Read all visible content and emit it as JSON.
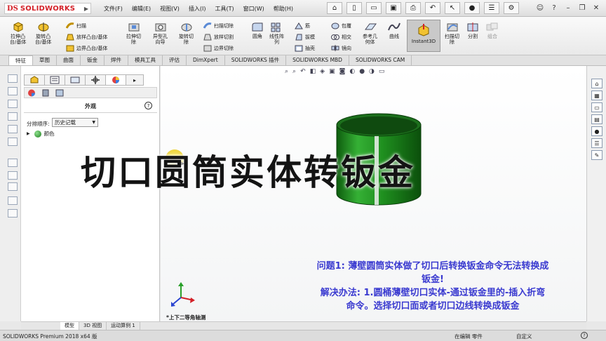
{
  "app": {
    "logo_mark": "DS",
    "logo_text": "SOLIDWORKS"
  },
  "menu": [
    "文件(F)",
    "编辑(E)",
    "视图(V)",
    "插入(I)",
    "工具(T)",
    "窗口(W)",
    "帮助(H)"
  ],
  "quick_toolbar_icons": [
    "home-icon",
    "new-document-icon",
    "open-icon",
    "save-icon",
    "print-icon",
    "undo-icon",
    "select-arrow-icon",
    "traffic-light-icon",
    "options-icon",
    "gear-icon"
  ],
  "window_controls": [
    "user-icon",
    "help-icon",
    "minimize-icon",
    "restore-icon",
    "close-icon"
  ],
  "ribbon": {
    "large": [
      {
        "label1": "拉伸凸",
        "label2": "台/基体"
      },
      {
        "label1": "旋转凸",
        "label2": "台/基体"
      },
      {
        "label1": "拉伸切",
        "label2": "除"
      },
      {
        "label1": "异型孔",
        "label2": "向导"
      },
      {
        "label1": "旋转切",
        "label2": "除"
      },
      {
        "label1": "圆角",
        "label2": ""
      },
      {
        "label1": "线性阵",
        "label2": "列"
      },
      {
        "label1": "参考几",
        "label2": "何体"
      },
      {
        "label1": "曲线",
        "label2": ""
      },
      {
        "label1": "扫描切",
        "label2": "除"
      },
      {
        "label1": "分割",
        "label2": ""
      },
      {
        "label1": "组合",
        "label2": ""
      }
    ],
    "small": {
      "sweep": "扫描",
      "loft_boss": "放样凸台/基体",
      "boundary_boss": "边界凸台/基体",
      "sweep_cut": "扫描切除",
      "loft_cut": "放样切割",
      "boundary_cut": "边界切除",
      "rib": "筋",
      "draft": "拔模",
      "shell": "抽壳",
      "wrap": "包覆",
      "intersect": "相交",
      "mirror": "镜向"
    },
    "instant3d": "Instant3D"
  },
  "tabs": [
    "特征",
    "草图",
    "曲面",
    "钣金",
    "焊件",
    "模具工具",
    "评估",
    "DimXpert",
    "SOLIDWORKS 插件",
    "SOLIDWORKS MBD",
    "SOLIDWORKS CAM"
  ],
  "panel": {
    "title": "外观",
    "help": "?",
    "sort_label": "分排顺序:",
    "sort_value": "历史记载",
    "tree_item": "颜色"
  },
  "viewport": {
    "view_name": "*上下二等角轴测",
    "overlay_title": "切口圆筒实体转钣金",
    "problem_line1": "问题1: 薄壁圆筒实体做了切口后转换钣金命令无法转换成",
    "problem_line2": "钣金!",
    "problem_line3": "解决办法: 1.圆桶薄壁切口实体-通过钣金里的-插入折弯",
    "problem_line4": "命令。选择切口面或者切口边线转换成钣金"
  },
  "bottom_tabs": [
    "模型",
    "3D 视图",
    "运动算例 1"
  ],
  "status": {
    "version": "SOLIDWORKS Premium 2018 x64 版",
    "editing": "在编辑 零件",
    "custom": "自定义"
  },
  "colors": {
    "brand_red": "#d32027",
    "cylinder_green": "#1c8a1c",
    "problem_text": "#3a3ad0"
  }
}
